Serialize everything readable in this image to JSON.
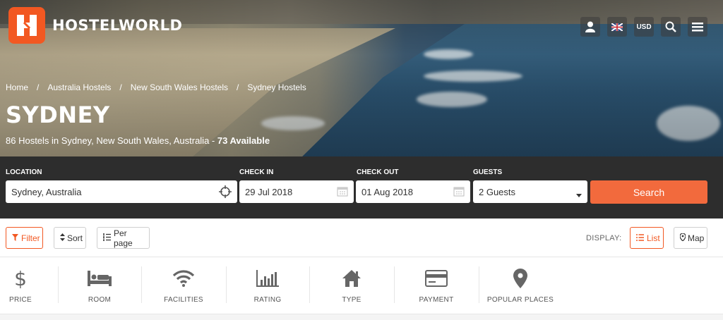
{
  "header": {
    "brand": "HOSTELWORLD",
    "currency": "USD"
  },
  "icons": {
    "account": "user-icon",
    "language": "uk-flag-icon",
    "search": "search-icon",
    "menu": "hamburger-menu-icon"
  },
  "colors": {
    "brand_orange": "#f25822",
    "search_bar_bg": "#2d2d2d",
    "search_button": "#f26a3d"
  },
  "breadcrumb": [
    "Home",
    "Australia Hostels",
    "New South Wales Hostels",
    "Sydney Hostels"
  ],
  "page": {
    "title": "SYDNEY",
    "subtitle_prefix": "86 Hostels in Sydney, New South Wales, Australia - ",
    "subtitle_available": "73 Available"
  },
  "search": {
    "location_label": "LOCATION",
    "location_value": "Sydney, Australia",
    "checkin_label": "CHECK IN",
    "checkin_value": "29 Jul 2018",
    "checkout_label": "CHECK OUT",
    "checkout_value": "01 Aug 2018",
    "guests_label": "GUESTS",
    "guests_value": "2 Guests",
    "button_label": "Search"
  },
  "toolbar": {
    "filter_label": "Filter",
    "sort_label": "Sort",
    "perpage_label": "Per page",
    "display_label": "DISPLAY:",
    "list_label": "List",
    "map_label": "Map"
  },
  "categories": [
    {
      "label": "PRICE",
      "icon": "dollar-icon"
    },
    {
      "label": "ROOM",
      "icon": "bed-icon"
    },
    {
      "label": "FACILITIES",
      "icon": "wifi-icon"
    },
    {
      "label": "RATING",
      "icon": "bar-chart-icon"
    },
    {
      "label": "TYPE",
      "icon": "house-icon"
    },
    {
      "label": "PAYMENT",
      "icon": "credit-card-icon"
    },
    {
      "label": "POPULAR PLACES",
      "icon": "map-pin-icon"
    }
  ]
}
